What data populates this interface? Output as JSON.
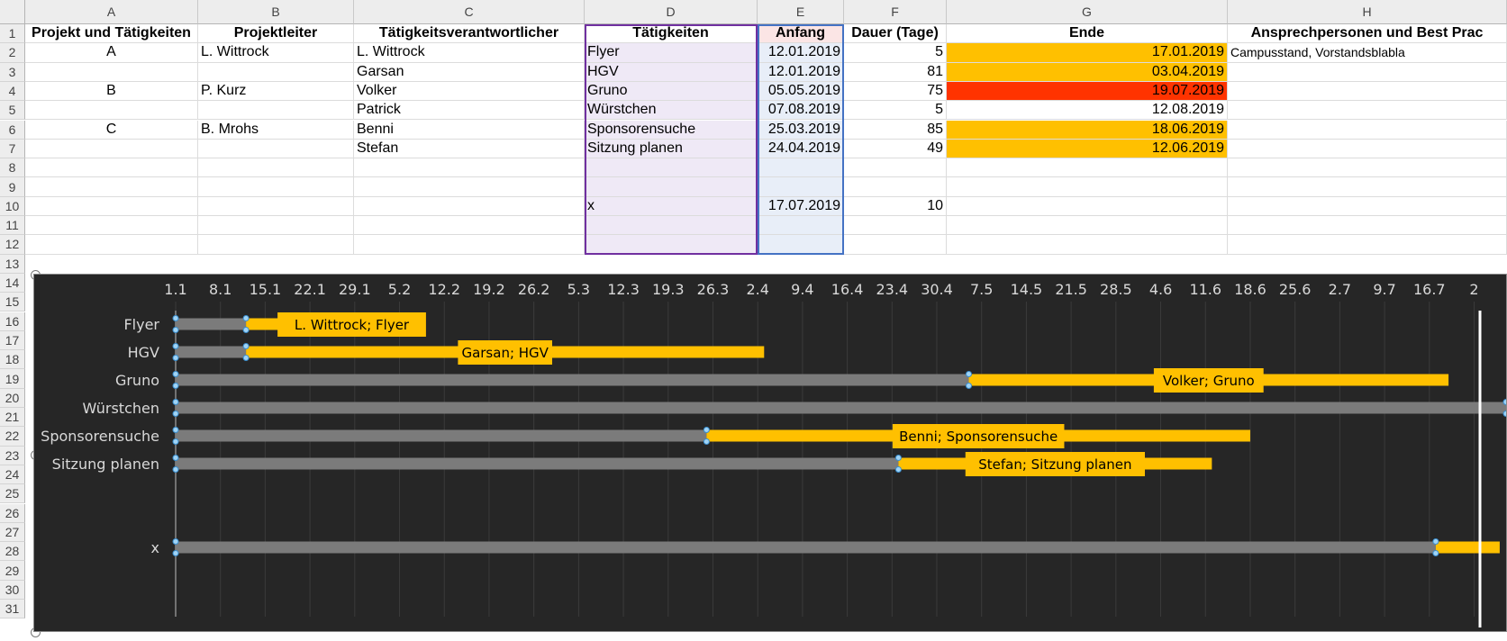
{
  "columns": [
    "A",
    "B",
    "C",
    "D",
    "E",
    "F",
    "G",
    "H"
  ],
  "rows": [
    "1",
    "2",
    "3",
    "4",
    "5",
    "6",
    "7",
    "8",
    "9",
    "10",
    "11",
    "12",
    "13",
    "14",
    "15",
    "16",
    "17",
    "18",
    "19",
    "20",
    "21",
    "22",
    "23",
    "24",
    "25",
    "26",
    "27",
    "28",
    "29",
    "30",
    "31"
  ],
  "headers": {
    "A": "Projekt und Tätigkeiten",
    "B": "Projektleiter",
    "C": "Tätigkeitsverantwortlicher",
    "D": "Tätigkeiten",
    "E": "Anfang",
    "F": "Dauer (Tage)",
    "G": "Ende",
    "H": "Ansprechpersonen und Best Prac"
  },
  "table": [
    {
      "A": "A",
      "B": "L. Wittrock",
      "C": "L. Wittrock",
      "D": "Flyer",
      "E": "12.01.2019",
      "F": "5",
      "G": "17.01.2019",
      "H": "Campusstand, Vorstandsblabla",
      "status": "warn"
    },
    {
      "A": "",
      "B": "",
      "C": "Garsan",
      "D": "HGV",
      "E": "12.01.2019",
      "F": "81",
      "G": "03.04.2019",
      "H": "",
      "status": "warn"
    },
    {
      "A": "B",
      "B": "P. Kurz",
      "C": "Volker",
      "D": "Gruno",
      "E": "05.05.2019",
      "F": "75",
      "G": "19.07.2019",
      "H": "",
      "status": "late"
    },
    {
      "A": "",
      "B": "",
      "C": "Patrick",
      "D": "Würstchen",
      "E": "07.08.2019",
      "F": "5",
      "G": "12.08.2019",
      "H": "",
      "status": "none"
    },
    {
      "A": "C",
      "B": "B. Mrohs",
      "C": "Benni",
      "D": "Sponsorensuche",
      "E": "25.03.2019",
      "F": "85",
      "G": "18.06.2019",
      "H": "",
      "status": "warn"
    },
    {
      "A": "",
      "B": "",
      "C": "Stefan",
      "D": "Sitzung planen",
      "E": "24.04.2019",
      "F": "49",
      "G": "12.06.2019",
      "H": "",
      "status": "warn"
    },
    {
      "A": "",
      "B": "",
      "C": "",
      "D": "",
      "E": "",
      "F": "",
      "G": "",
      "H": "",
      "status": "none"
    },
    {
      "A": "",
      "B": "",
      "C": "",
      "D": "",
      "E": "",
      "F": "",
      "G": "",
      "H": "",
      "status": "none"
    },
    {
      "A": "",
      "B": "",
      "C": "",
      "D": "x",
      "E": "17.07.2019",
      "F": "10",
      "G": "",
      "H": "",
      "status": "none"
    },
    {
      "A": "",
      "B": "",
      "C": "",
      "D": "",
      "E": "",
      "F": "",
      "G": "",
      "H": "",
      "status": "none"
    },
    {
      "A": "",
      "B": "",
      "C": "",
      "D": "",
      "E": "",
      "F": "",
      "G": "",
      "H": "",
      "status": "none"
    }
  ],
  "colors": {
    "warn": "#ffc000",
    "late": "#ff3300",
    "chart_bg": "#262626",
    "offset_bar": "#7b7b7b",
    "duration_bar": "#ffc000",
    "select_purple": "#7030a0",
    "select_blue": "#4472c4"
  },
  "chart_data": {
    "type": "bar",
    "orientation": "horizontal",
    "stacked": true,
    "title": "",
    "xlabel": "",
    "ylabel": "",
    "x_tick_labels": [
      "1.1",
      "8.1",
      "15.1",
      "22.1",
      "29.1",
      "5.2",
      "12.2",
      "19.2",
      "26.2",
      "5.3",
      "12.3",
      "19.3",
      "26.3",
      "2.4",
      "9.4",
      "16.4",
      "23.4",
      "30.4",
      "7.5",
      "14.5",
      "21.5",
      "28.5",
      "4.6",
      "11.6",
      "18.6",
      "25.6",
      "2.7",
      "9.7",
      "16.7",
      "2"
    ],
    "xlim": [
      "2019-01-01",
      "2019-07-28"
    ],
    "categories": [
      "Flyer",
      "HGV",
      "Gruno",
      "Würstchen",
      "Sponsorensuche",
      "Sitzung planen",
      "",
      "",
      "x"
    ],
    "series": [
      {
        "values": [
          "2019-01-12",
          "2019-01-12",
          "2019-05-05",
          "2019-08-07",
          "2019-03-25",
          "2019-04-24",
          null,
          null,
          "2019-07-17"
        ]
      },
      {
        "values": [
          5,
          81,
          75,
          5,
          85,
          49,
          null,
          null,
          10
        ]
      }
    ],
    "data_labels": [
      "L. Wittrock; Flyer",
      "Garsan; HGV",
      "Volker; Gruno",
      "",
      "Benni; Sponsorensuche",
      "Stefan; Sitzung planen",
      "",
      "",
      ""
    ],
    "grid": true,
    "legend": "none"
  }
}
